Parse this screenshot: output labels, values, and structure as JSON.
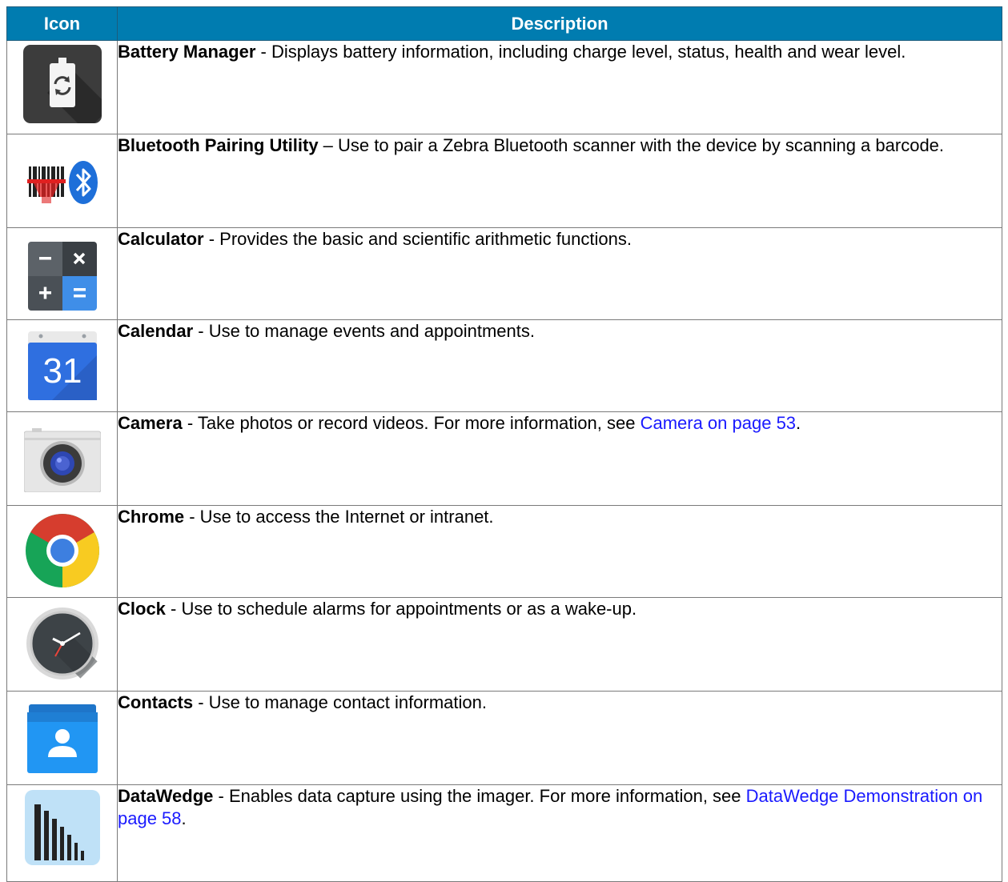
{
  "table": {
    "headers": {
      "icon": "Icon",
      "description": "Description"
    },
    "rows": [
      {
        "icon": "battery-manager-icon",
        "name": "Battery Manager",
        "text": " - Displays battery information, including charge level, status, health and wear level."
      },
      {
        "icon": "bluetooth-pairing-icon",
        "name": "Bluetooth Pairing Utility",
        "text": " – Use to pair a Zebra Bluetooth scanner with the device by scanning a barcode."
      },
      {
        "icon": "calculator-icon",
        "name": "Calculator",
        "text": " - Provides the basic and scientific arithmetic functions."
      },
      {
        "icon": "calendar-icon",
        "icon_text": "31",
        "name": "Calendar",
        "text": " - Use to manage events and appointments."
      },
      {
        "icon": "camera-icon",
        "name": "Camera",
        "text": " - Take photos or record videos. For more information, see ",
        "link": "Camera on page 53",
        "after": "."
      },
      {
        "icon": "chrome-icon",
        "name": "Chrome",
        "text": " - Use to access the Internet or intranet."
      },
      {
        "icon": "clock-icon",
        "name": "Clock",
        "text": " - Use to schedule alarms for appointments or as a wake-up."
      },
      {
        "icon": "contacts-icon",
        "name": "Contacts",
        "text": " - Use to manage contact information."
      },
      {
        "icon": "datawedge-icon",
        "name": "DataWedge",
        "text": " - Enables data capture using the imager. For more information, see ",
        "link": "DataWedge Demonstration on page 58",
        "after": "."
      }
    ]
  },
  "colors": {
    "header_bg": "#007cb0",
    "link": "#1a1aff"
  }
}
